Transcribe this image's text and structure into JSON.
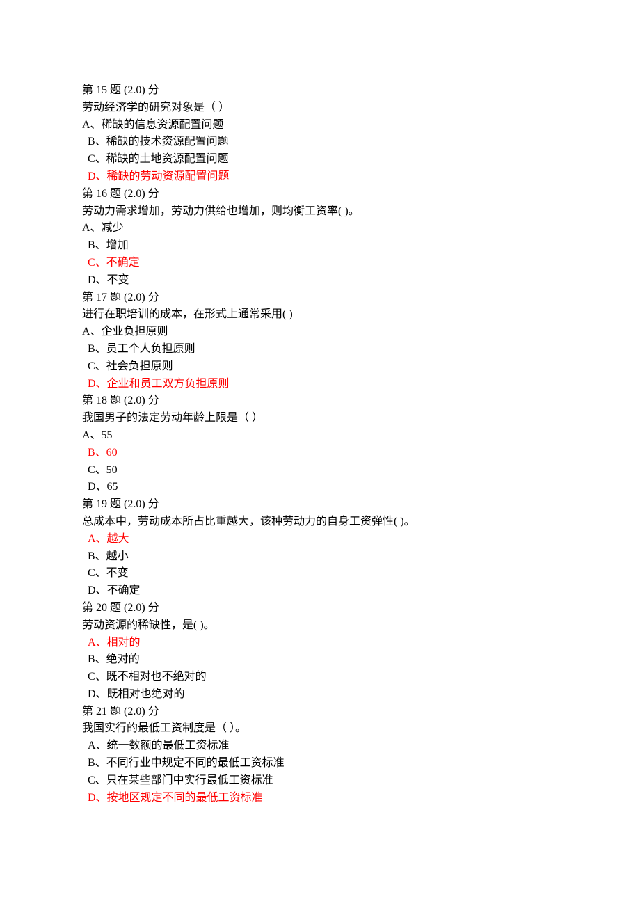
{
  "questions": [
    {
      "header": "第 15 题  (2.0)  分",
      "stem": "劳动经济学的研究对象是（     ）",
      "options": [
        {
          "text": "A、稀缺的信息资源配置问题",
          "cls": "opt-first"
        },
        {
          "text": "B、稀缺的技术资源配置问题",
          "cls": "opt-rest"
        },
        {
          "text": "C、稀缺的土地资源配置问题",
          "cls": "opt-rest"
        },
        {
          "text": "D、稀缺的劳动资源配置问题",
          "cls": "opt-rest answer"
        }
      ]
    },
    {
      "header": "第 16 题  (2.0)  分",
      "stem": "劳动力需求增加，劳动力供给也增加，则均衡工资率(         )。",
      "options": [
        {
          "text": "A、减少",
          "cls": "opt-first"
        },
        {
          "text": "B、增加",
          "cls": "opt-rest"
        },
        {
          "text": "C、不确定",
          "cls": "opt-rest answer"
        },
        {
          "text": "D、不变",
          "cls": "opt-rest"
        }
      ]
    },
    {
      "header": "第 17 题  (2.0)  分",
      "stem": "进行在职培训的成本，在形式上通常采用(         )",
      "options": [
        {
          "text": "A、企业负担原则",
          "cls": "opt-first"
        },
        {
          "text": "B、员工个人负担原则",
          "cls": "opt-rest"
        },
        {
          "text": "C、社会负担原则",
          "cls": "opt-rest"
        },
        {
          "text": "D、企业和员工双方负担原则",
          "cls": "opt-rest answer"
        }
      ]
    },
    {
      "header": "第 18 题  (2.0)  分",
      "stem": " 我国男子的法定劳动年龄上限是（    ）",
      "options": [
        {
          "text": "A、55",
          "cls": "opt-first"
        },
        {
          "text": "B、60",
          "cls": "opt-rest answer"
        },
        {
          "text": "C、50",
          "cls": "opt-rest"
        },
        {
          "text": "D、65",
          "cls": "opt-rest"
        }
      ]
    },
    {
      "header": "第 19 题  (2.0)  分",
      "stem": "总成本中，劳动成本所占比重越大，该种劳动力的自身工资弹性(         )。",
      "options": [
        {
          "text": "A、越大",
          "cls": "opt-rest answer"
        },
        {
          "text": "B、越小",
          "cls": "opt-rest"
        },
        {
          "text": "C、不变",
          "cls": "opt-rest"
        },
        {
          "text": "D、不确定",
          "cls": "opt-rest"
        }
      ]
    },
    {
      "header": "第 20 题  (2.0)  分",
      "stem": "劳动资源的稀缺性，是(          )。",
      "options": [
        {
          "text": "A、相对的",
          "cls": "opt-rest answer"
        },
        {
          "text": "B、绝对的",
          "cls": "opt-rest"
        },
        {
          "text": "C、既不相对也不绝对的",
          "cls": "opt-rest"
        },
        {
          "text": "D、既相对也绝对的",
          "cls": "opt-rest"
        }
      ]
    },
    {
      "header": "第 21 题  (2.0)  分",
      "stem": "我国实行的最低工资制度是（       ）。",
      "options": [
        {
          "text": "A、统一数额的最低工资标准",
          "cls": "opt-rest"
        },
        {
          "text": "B、不同行业中规定不同的最低工资标准",
          "cls": "opt-rest"
        },
        {
          "text": "C、只在某些部门中实行最低工资标准",
          "cls": "opt-rest"
        },
        {
          "text": "D、按地区规定不同的最低工资标准",
          "cls": "opt-rest answer"
        }
      ]
    }
  ]
}
